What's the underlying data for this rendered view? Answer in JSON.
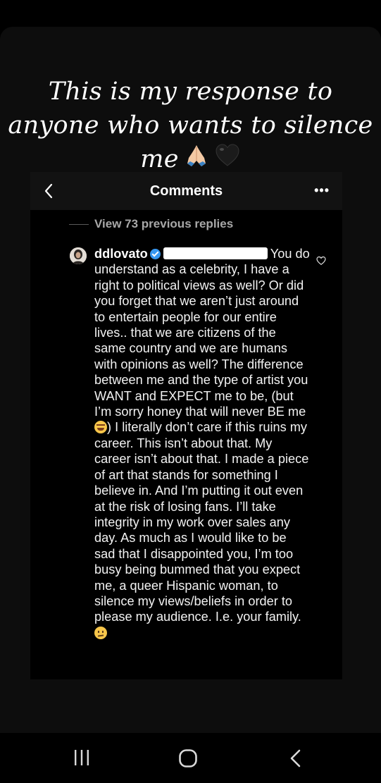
{
  "story": {
    "caption_lines": [
      "This is my response to",
      "anyone who wants to silence",
      "me"
    ],
    "caption_emojis": [
      "folded-hands-emoji",
      "black-heart-emoji"
    ]
  },
  "header": {
    "title": "Comments",
    "back_icon": "chevron-left-icon",
    "more_label": "•••"
  },
  "thread": {
    "view_replies_label": "View 73 previous replies"
  },
  "comment": {
    "username": "ddlovato",
    "text_part1": "You do understand as a celebrity, I have a right to political views as well? Or did you forget that we aren’t just around to entertain people for our entire  lives.. that we are citizens of the same country and we are humans with opinions as well? The difference between me and the type of artist you WANT and EXPECT me to be, (but I’m sorry honey that will never BE me ",
    "text_part2": ") I literally don’t care if this ruins my career. This isn’t about that. My career isn’t about that. I made a piece of art that stands for something I believe in. And I’m putting it out even at the risk of losing fans. I’ll take integrity in my work over sales any day. As much as I would like to be sad that I disappointed you, I’m too busy being bummed that you expect me, a queer Hispanic woman, to silence my views/beliefs in order to please my audience. I.e. your family. ",
    "like_icon": "heart-outline-icon"
  },
  "colors": {
    "background": "#000000",
    "header_bg": "#121212",
    "verified_blue": "#3797f0",
    "muted_text": "#a8a8a8"
  },
  "system_nav": [
    "recents-icon",
    "home-icon",
    "back-icon"
  ]
}
